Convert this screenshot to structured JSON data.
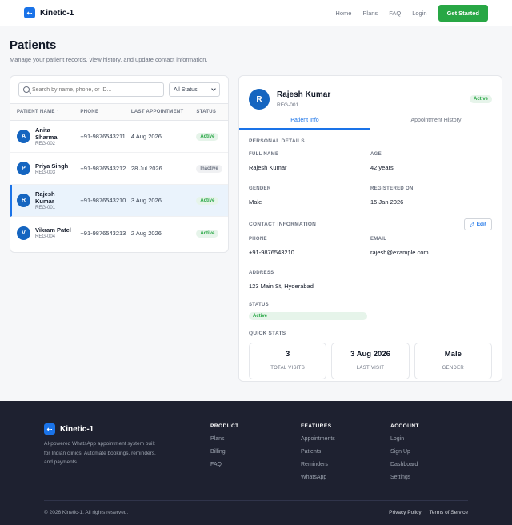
{
  "nav": {
    "brand": "Kinetic-1",
    "links": [
      "Home",
      "Plans",
      "FAQ",
      "Login"
    ],
    "cta": "Get Started"
  },
  "header": {
    "title": "Patients",
    "subtitle": "Manage your patient records, view history, and update contact information."
  },
  "list": {
    "search_placeholder": "Search by name, phone, or ID...",
    "status_filter": "All Status",
    "columns": [
      "PATIENT NAME ↑",
      "PHONE",
      "LAST APPOINTMENT",
      "STATUS"
    ],
    "rows": [
      {
        "initial": "A",
        "name": "Anita Sharma",
        "reg": "REG-002",
        "phone": "+91-9876543211",
        "last": "4 Aug 2026",
        "status": "Active"
      },
      {
        "initial": "P",
        "name": "Priya Singh",
        "reg": "REG-003",
        "phone": "+91-9876543212",
        "last": "28 Jul 2026",
        "status": "Inactive"
      },
      {
        "initial": "R",
        "name": "Rajesh Kumar",
        "reg": "REG-001",
        "phone": "+91-9876543210",
        "last": "3 Aug 2026",
        "status": "Active"
      },
      {
        "initial": "V",
        "name": "Vikram Patel",
        "reg": "REG-004",
        "phone": "+91-9876543213",
        "last": "2 Aug 2026",
        "status": "Active"
      }
    ]
  },
  "detail": {
    "initial": "R",
    "name": "Rajesh Kumar",
    "reg": "REG-001",
    "status": "Active",
    "tabs": [
      "Patient Info",
      "Appointment History"
    ],
    "personal_title": "PERSONAL DETAILS",
    "full_name_label": "FULL NAME",
    "full_name": "Rajesh Kumar",
    "age_label": "AGE",
    "age": "42 years",
    "gender_label": "GENDER",
    "gender": "Male",
    "registered_label": "REGISTERED ON",
    "registered": "15 Jan 2026",
    "contact_title": "CONTACT INFORMATION",
    "edit_label": "Edit",
    "phone_label": "PHONE",
    "phone": "+91-9876543210",
    "email_label": "EMAIL",
    "email": "rajesh@example.com",
    "address_label": "ADDRESS",
    "address": "123 Main St, Hyderabad",
    "status_label": "STATUS",
    "quick_title": "QUICK STATS",
    "stats": [
      {
        "value": "3",
        "label": "TOTAL VISITS"
      },
      {
        "value": "3 Aug 2026",
        "label": "LAST VISIT"
      },
      {
        "value": "Male",
        "label": "GENDER"
      }
    ]
  },
  "footer": {
    "brand": "Kinetic-1",
    "desc": "AI-powered WhatsApp appointment system built for Indian clinics. Automate bookings, reminders, and payments.",
    "columns": [
      {
        "title": "PRODUCT",
        "links": [
          "Plans",
          "Billing",
          "FAQ"
        ]
      },
      {
        "title": "FEATURES",
        "links": [
          "Appointments",
          "Patients",
          "Reminders",
          "WhatsApp"
        ]
      },
      {
        "title": "ACCOUNT",
        "links": [
          "Login",
          "Sign Up",
          "Dashboard",
          "Settings"
        ]
      }
    ],
    "copyright": "© 2026 Kinetic-1. All rights reserved.",
    "legal": [
      "Privacy Policy",
      "Terms of Service"
    ]
  }
}
